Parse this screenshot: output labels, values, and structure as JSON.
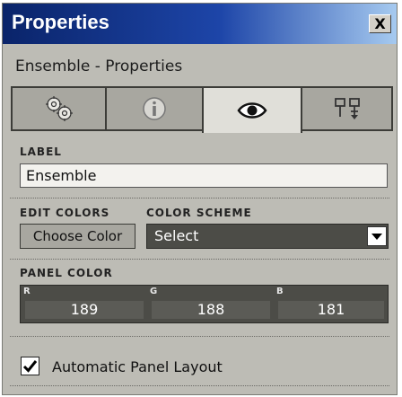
{
  "window": {
    "title": "Properties",
    "close_label": "X"
  },
  "subtitle": "Ensemble - Properties",
  "tabs": [
    {
      "icon": "gears-icon",
      "active": false
    },
    {
      "icon": "info-icon",
      "active": false
    },
    {
      "icon": "eye-icon",
      "active": true
    },
    {
      "icon": "panel-layout-icon",
      "active": false
    }
  ],
  "label_section": {
    "heading": "LABEL",
    "value": "Ensemble"
  },
  "edit_colors": {
    "heading": "EDIT COLORS",
    "button_label": "Choose Color"
  },
  "color_scheme": {
    "heading": "COLOR SCHEME",
    "selected": "Select"
  },
  "panel_color": {
    "heading": "PANEL COLOR",
    "channels": [
      {
        "label": "R",
        "value": "189"
      },
      {
        "label": "G",
        "value": "188"
      },
      {
        "label": "B",
        "value": "181"
      }
    ]
  },
  "auto_layout": {
    "label": "Automatic Panel Layout",
    "checked": true
  },
  "colors": {
    "panel_bg": "#bdbcb5",
    "dark_field": "#4c4c47",
    "titlebar": "#0a246a"
  }
}
